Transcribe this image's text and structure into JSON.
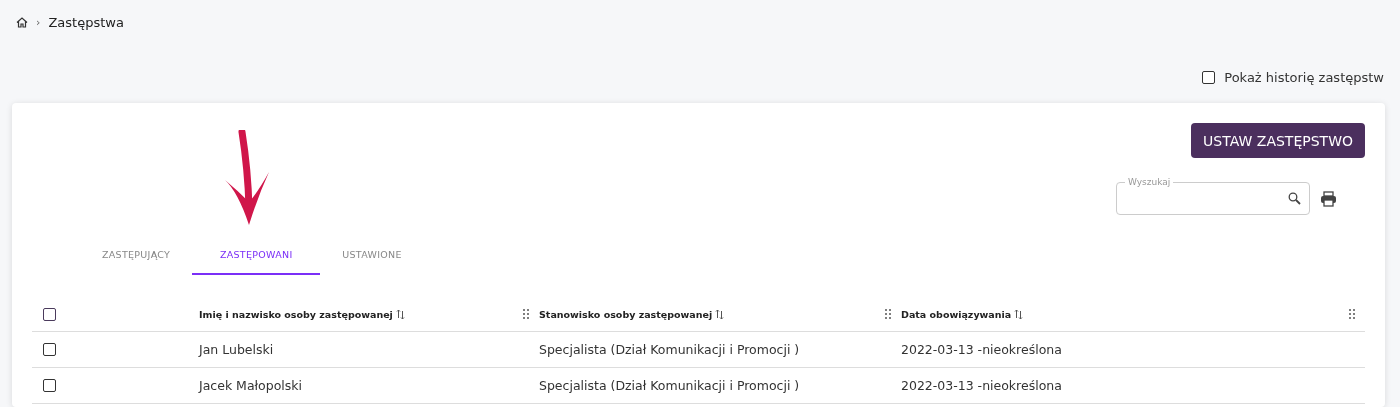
{
  "breadcrumb": {
    "separator": "›",
    "current": "Zastępstwa"
  },
  "history_toggle": {
    "label": "Pokaż historię zastępstw",
    "checked": false
  },
  "action_button": "USTAW ZASTĘPSTWO",
  "search": {
    "label": "Wyszukaj"
  },
  "tabs": [
    {
      "label": "ZASTĘPUJĄCY",
      "selected": false
    },
    {
      "label": "ZASTĘPOWANI",
      "selected": true
    },
    {
      "label": "USTAWIONE",
      "selected": false
    }
  ],
  "table": {
    "select_all_checked": false,
    "columns": [
      "Imię i nazwisko osoby zastępowanej",
      "Stanowisko osoby zastępowanej",
      "Data obowiązywania"
    ],
    "rows": [
      {
        "checked": false,
        "cells": [
          "Jan Lubelski",
          "Specjalista (Dział Komunikacji i Promocji )",
          "2022-03-13 -nieokreślona"
        ]
      },
      {
        "checked": false,
        "cells": [
          "Jacek Małopolski",
          "Specjalista (Dział Komunikacji i Promocji )",
          "2022-03-13 -nieokreślona"
        ]
      }
    ]
  }
}
